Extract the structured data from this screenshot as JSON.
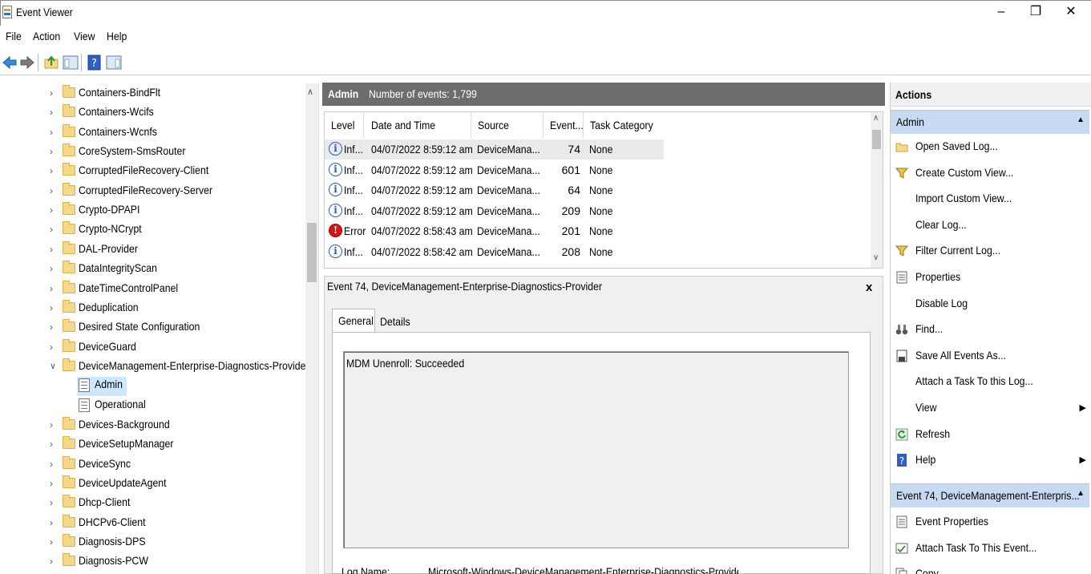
{
  "window": {
    "title": "Event Viewer",
    "minimize": "–",
    "maximize": "❐",
    "close": "✕"
  },
  "menu": [
    "File",
    "Action",
    "View",
    "Help"
  ],
  "tree": {
    "items": [
      {
        "label": "Containers-BindFlt",
        "expanded": false
      },
      {
        "label": "Containers-Wcifs",
        "expanded": false
      },
      {
        "label": "Containers-Wcnfs",
        "expanded": false
      },
      {
        "label": "CoreSystem-SmsRouter",
        "expanded": false
      },
      {
        "label": "CorruptedFileRecovery-Client",
        "expanded": false
      },
      {
        "label": "CorruptedFileRecovery-Server",
        "expanded": false
      },
      {
        "label": "Crypto-DPAPI",
        "expanded": false
      },
      {
        "label": "Crypto-NCrypt",
        "expanded": false
      },
      {
        "label": "DAL-Provider",
        "expanded": false
      },
      {
        "label": "DataIntegrityScan",
        "expanded": false
      },
      {
        "label": "DateTimeControlPanel",
        "expanded": false
      },
      {
        "label": "Deduplication",
        "expanded": false
      },
      {
        "label": "Desired State Configuration",
        "expanded": false
      },
      {
        "label": "DeviceGuard",
        "expanded": false
      },
      {
        "label": "DeviceManagement-Enterprise-Diagnostics-Provider",
        "expanded": true
      }
    ],
    "children": [
      {
        "label": "Admin",
        "selected": true
      },
      {
        "label": "Operational",
        "selected": false
      }
    ],
    "items_after": [
      {
        "label": "Devices-Background"
      },
      {
        "label": "DeviceSetupManager"
      },
      {
        "label": "DeviceSync"
      },
      {
        "label": "DeviceUpdateAgent"
      },
      {
        "label": "Dhcp-Client"
      },
      {
        "label": "DHCPv6-Client"
      },
      {
        "label": "Diagnosis-DPS"
      },
      {
        "label": "Diagnosis-PCW"
      }
    ]
  },
  "log_header": {
    "name": "Admin",
    "count_text": "Number of events: 1,799"
  },
  "grid": {
    "columns": [
      "Level",
      "Date and Time",
      "Source",
      "Event...",
      "Task Category"
    ],
    "rows": [
      {
        "level": "Inf...",
        "type": "info",
        "date": "04/07/2022 8:59:12 am",
        "source": "DeviceMana...",
        "event": "74",
        "category": "None"
      },
      {
        "level": "Inf...",
        "type": "info",
        "date": "04/07/2022 8:59:12 am",
        "source": "DeviceMana...",
        "event": "601",
        "category": "None"
      },
      {
        "level": "Inf...",
        "type": "info",
        "date": "04/07/2022 8:59:12 am",
        "source": "DeviceMana...",
        "event": "64",
        "category": "None"
      },
      {
        "level": "Inf...",
        "type": "info",
        "date": "04/07/2022 8:59:12 am",
        "source": "DeviceMana...",
        "event": "209",
        "category": "None"
      },
      {
        "level": "Error",
        "type": "error",
        "date": "04/07/2022 8:58:43 am",
        "source": "DeviceMana...",
        "event": "201",
        "category": "None"
      },
      {
        "level": "Inf...",
        "type": "info",
        "date": "04/07/2022 8:58:42 am",
        "source": "DeviceMana...",
        "event": "208",
        "category": "None"
      }
    ]
  },
  "detail": {
    "title": "Event 74, DeviceManagement-Enterprise-Diagnostics-Provider",
    "close": "x",
    "tabs": [
      "General",
      "Details"
    ],
    "message": "MDM Unenroll: Succeeded",
    "log_name_label": "Log Name:",
    "log_name_value": "Microsoft-Windows-DeviceManagement-Enterprise-Diagnostics-Provider/Admin"
  },
  "actions": {
    "title": "Actions",
    "section1": "Admin",
    "items1": [
      {
        "label": "Open Saved Log...",
        "icon": "folder-open-icon"
      },
      {
        "label": "Create Custom View...",
        "icon": "filter-icon"
      },
      {
        "label": "Import Custom View...",
        "icon": ""
      },
      {
        "label": "Clear Log...",
        "icon": ""
      },
      {
        "label": "Filter Current Log...",
        "icon": "filter-icon"
      },
      {
        "label": "Properties",
        "icon": "properties-icon"
      },
      {
        "label": "Disable Log",
        "icon": ""
      },
      {
        "label": "Find...",
        "icon": "binoculars-icon"
      },
      {
        "label": "Save All Events As...",
        "icon": "save-icon"
      },
      {
        "label": "Attach a Task To this Log...",
        "icon": ""
      },
      {
        "label": "View",
        "icon": "",
        "submenu": true
      },
      {
        "label": "Refresh",
        "icon": "refresh-icon"
      },
      {
        "label": "Help",
        "icon": "help-icon",
        "submenu": true
      }
    ],
    "section2": "Event 74, DeviceManagement-Enterpris...",
    "items2": [
      {
        "label": "Event Properties",
        "icon": "properties-icon"
      },
      {
        "label": "Attach Task To This Event...",
        "icon": "task-icon"
      },
      {
        "label": "Copy",
        "icon": "copy-icon"
      }
    ]
  },
  "colors": {
    "selection": "#cce8ff",
    "header_gray": "#6d6d6d",
    "section_blue": "#c6daf2",
    "error_red": "#d01818",
    "info_blue": "#2b5fb5"
  }
}
